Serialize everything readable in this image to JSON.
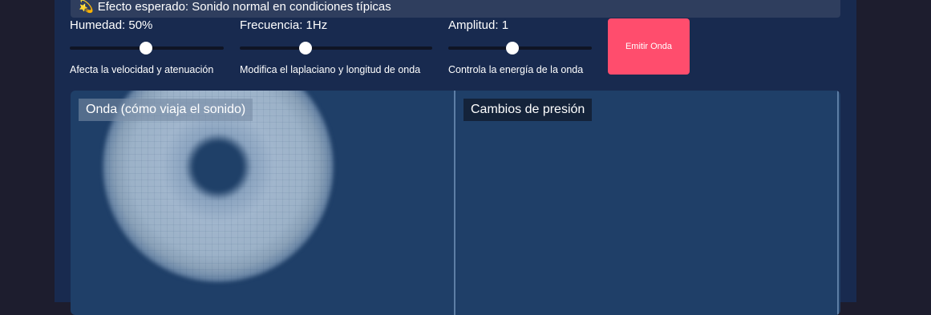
{
  "banner": {
    "icon": "sparkle-icon",
    "emoji": "💫",
    "text": "Efecto esperado: Sonido normal en condiciones típicas"
  },
  "controls": [
    {
      "label": "Humedad: 50%",
      "hint": "Afecta la velocidad y atenuación",
      "value_percent": 50
    },
    {
      "label": "Frecuencia: 1Hz",
      "hint": "Modifica el laplaciano y longitud de onda",
      "value_percent": 34
    },
    {
      "label": "Amplitud: 1",
      "hint": "Controla la energía de la onda",
      "value_percent": 45
    }
  ],
  "emit_button": {
    "label": "Emitir Onda"
  },
  "panels": {
    "left": {
      "label": "Onda (cómo viaja el sonido)"
    },
    "right": {
      "label": "Cambios de presión"
    }
  },
  "colors": {
    "accent": "#ff4d6d",
    "background": "#182a4f",
    "panel": "#1f3f68"
  }
}
